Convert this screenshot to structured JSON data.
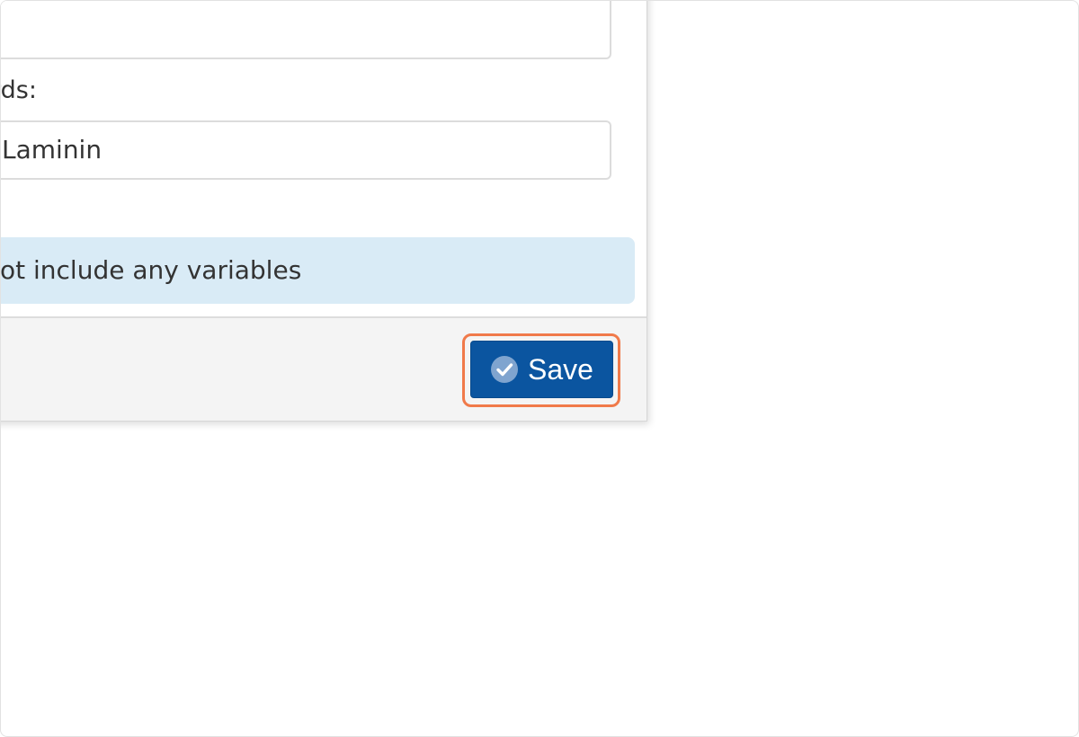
{
  "keywords": {
    "label": "rds:",
    "value": "Laminin"
  },
  "info": {
    "message": "ot include any variables"
  },
  "footer": {
    "save_label": "Save",
    "save_icon": "check-circle-icon"
  },
  "colors": {
    "primary_button": "#0b55a0",
    "highlight": "#f07a4a",
    "info_background": "#d9ebf6"
  }
}
